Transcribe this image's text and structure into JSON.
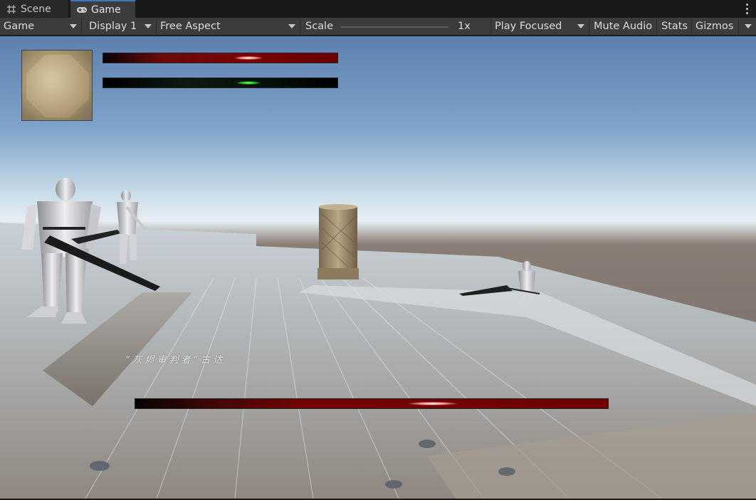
{
  "tabs": [
    {
      "label": "Scene",
      "icon": "grid-icon",
      "active": false
    },
    {
      "label": "Game",
      "icon": "gamepad-icon",
      "active": true
    }
  ],
  "toolbar": {
    "mode": "Game",
    "display": "Display 1",
    "aspect": "Free Aspect",
    "scale_label": "Scale",
    "scale_value": "1x",
    "play_mode": "Play Focused",
    "mute": "Mute Audio",
    "stats": "Stats",
    "gizmos": "Gizmos"
  },
  "hud": {
    "player_health": 0.62,
    "player_mana": 0.62,
    "boss_name": "“灰烬审判者”古达",
    "boss_health": 0.63
  },
  "colors": {
    "accent": "#3a79bb",
    "panel": "#3c3c3c",
    "health": "#6b0000",
    "mana_glow": "#22c022"
  }
}
